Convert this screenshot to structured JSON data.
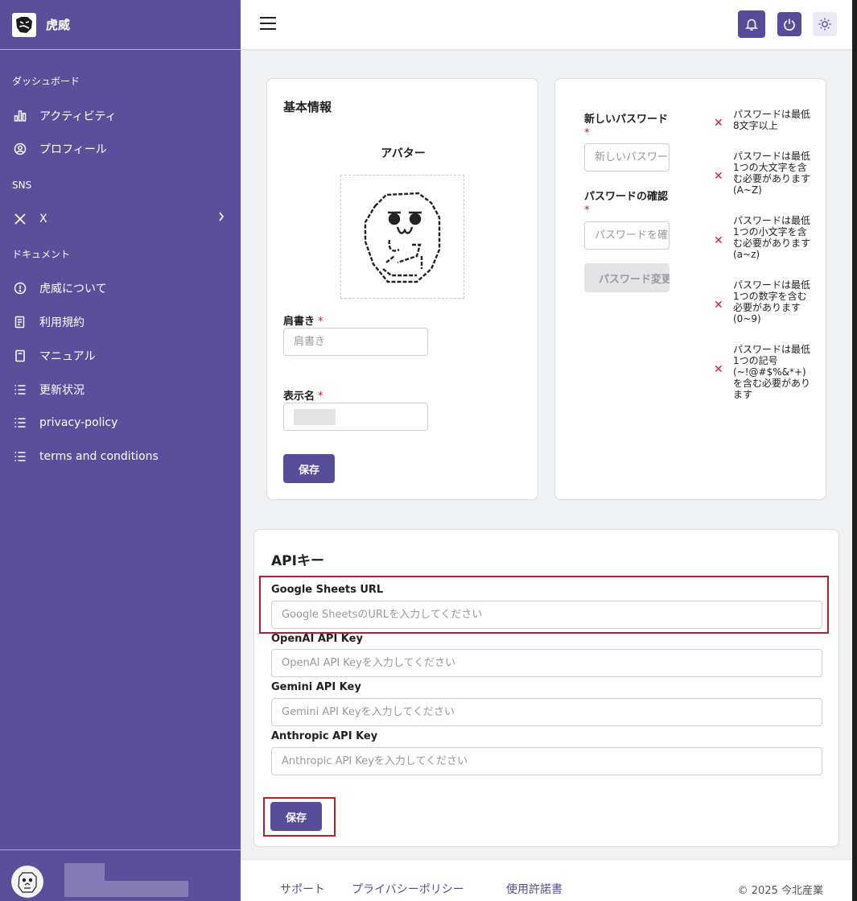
{
  "app": {
    "name": "虎威"
  },
  "sidebar": {
    "sections": {
      "dashboard": "ダッシュボード",
      "sns": "SNS",
      "documents": "ドキュメント"
    },
    "items": {
      "activity": "アクティビティ",
      "profile": "プロフィール",
      "x": "X",
      "about": "虎威について",
      "terms_of_use": "利用規約",
      "manual": "マニュアル",
      "updates": "更新状況",
      "privacy_policy": "privacy-policy",
      "terms_and_conditions": "terms and conditions"
    }
  },
  "topbar": {
    "icons": [
      "menu-icon",
      "bell-icon",
      "power-icon",
      "sun-icon"
    ],
    "accent": "#574c98"
  },
  "basic_info": {
    "title": "基本情報",
    "avatar_label": "アバター",
    "title_field": {
      "label": "肩書き",
      "required": "*",
      "placeholder": "肩書き"
    },
    "display_name_field": {
      "label": "表示名",
      "required": "*"
    },
    "save": "保存"
  },
  "password": {
    "new_label": "新しいパスワード",
    "new_required": "*",
    "new_placeholder": "新しいパスワード",
    "confirm_label": "パスワードの確認",
    "confirm_required": "*",
    "confirm_placeholder": "パスワードを確認",
    "submit": "パスワード変更",
    "rules": [
      "パスワードは最低8文字以上",
      "パスワードは最低1つの大文字を含む必要があります(A~Z)",
      "パスワードは最低1つの小文字を含む必要があります(a~z)",
      "パスワードは最低1つの数字を含む必要があります(0~9)",
      "パスワードは最低1つの記号(~!@#$%&*+)を含む必要があります"
    ],
    "rule_mark": "✕"
  },
  "api_keys": {
    "title": "APIキー",
    "google_sheets": {
      "label": "Google Sheets URL",
      "placeholder": "Google SheetsのURLを入力してください"
    },
    "openai": {
      "label": "OpenAI API Key",
      "placeholder": "OpenAI API Keyを入力してください"
    },
    "gemini": {
      "label": "Gemini API Key",
      "placeholder": "Gemini API Keyを入力してください"
    },
    "anthropic": {
      "label": "Anthropic API Key",
      "placeholder": "Anthropic API Keyを入力してください"
    },
    "save": "保存"
  },
  "footer": {
    "support": "サポート",
    "privacy": "プライバシーポリシー",
    "license": "使用許諾書",
    "copyright": "© 2025 今北産業"
  }
}
